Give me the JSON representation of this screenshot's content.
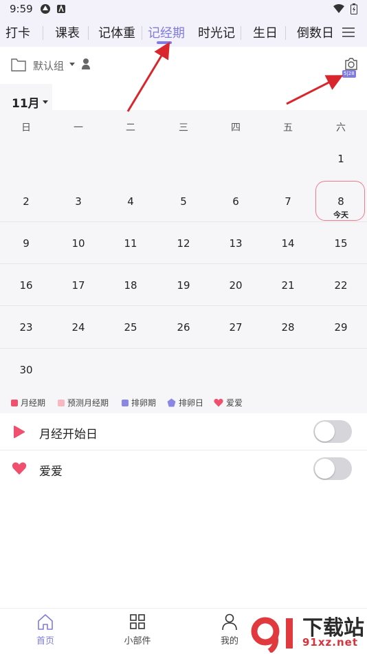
{
  "status_bar": {
    "time": "9:59"
  },
  "tabs": [
    {
      "label": "打卡"
    },
    {
      "label": "课表"
    },
    {
      "label": "记体重"
    },
    {
      "label": "记经期"
    },
    {
      "label": "时光记"
    },
    {
      "label": "生日"
    },
    {
      "label": "倒数日"
    }
  ],
  "active_tab": "记经期",
  "toolbar": {
    "group_label": "默认组",
    "camera_badge": "5|28"
  },
  "month": {
    "label": "11月"
  },
  "weekdays": [
    "日",
    "一",
    "二",
    "三",
    "四",
    "五",
    "六"
  ],
  "calendar": {
    "rows": [
      [
        "",
        "",
        "",
        "",
        "",
        "",
        "1"
      ],
      [
        "2",
        "3",
        "4",
        "5",
        "6",
        "7",
        "8"
      ],
      [
        "9",
        "10",
        "11",
        "12",
        "13",
        "14",
        "15"
      ],
      [
        "16",
        "17",
        "18",
        "19",
        "20",
        "21",
        "22"
      ],
      [
        "23",
        "24",
        "25",
        "26",
        "27",
        "28",
        "29"
      ],
      [
        "30",
        "",
        "",
        "",
        "",
        "",
        ""
      ]
    ],
    "today_label": "今天"
  },
  "legend": [
    {
      "label": "月经期",
      "color": "#f0506e",
      "shape": "square"
    },
    {
      "label": "预测月经期",
      "color": "#f7b8c2",
      "shape": "square"
    },
    {
      "label": "排卵期",
      "color": "#8a86e6",
      "shape": "square"
    },
    {
      "label": "排卵日",
      "color": "#8a86e6",
      "shape": "pentagon"
    },
    {
      "label": "爱爱",
      "color": "#f0506e",
      "shape": "heart"
    }
  ],
  "settings": [
    {
      "label": "月经开始日",
      "icon": "flag-icon",
      "on": false
    },
    {
      "label": "爱爱",
      "icon": "heart-icon",
      "on": false
    }
  ],
  "bottom_nav": [
    {
      "label": "首页",
      "icon": "home-icon",
      "active": true
    },
    {
      "label": "小部件",
      "icon": "widgets-icon",
      "active": false
    },
    {
      "label": "我的",
      "icon": "person-icon",
      "active": false
    }
  ],
  "watermark": {
    "text": "下载站",
    "url": "91xz.net",
    "logo": "91"
  },
  "colors": {
    "accent": "#7f7be0",
    "period": "#f0506e",
    "today_ring": "#f07a8a",
    "arrow": "#d9262c"
  }
}
